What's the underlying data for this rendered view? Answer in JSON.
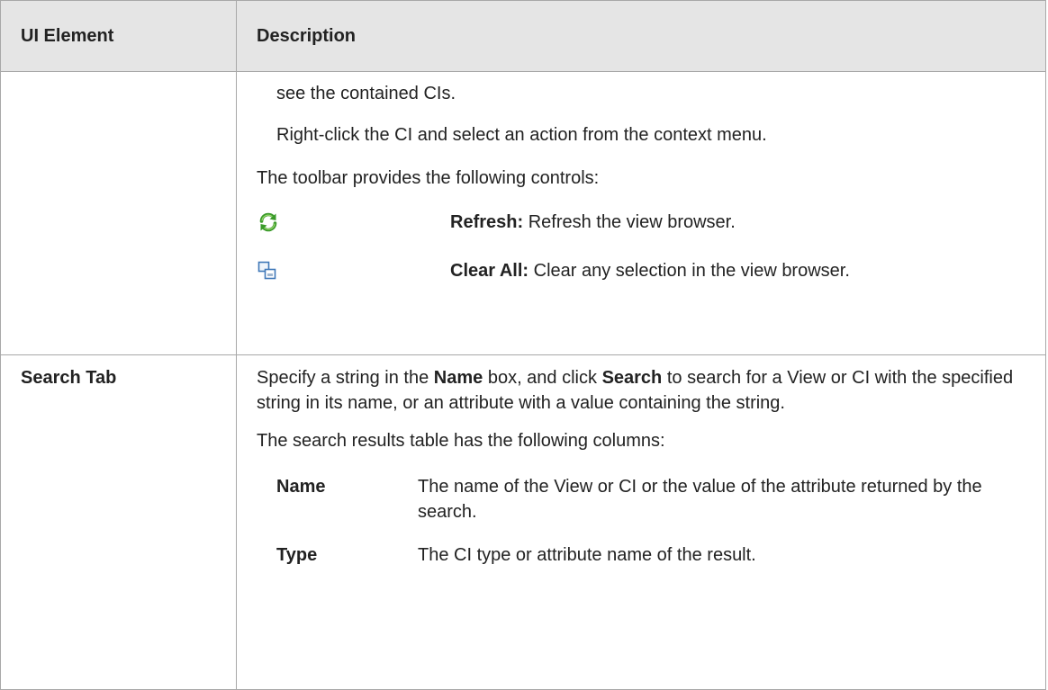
{
  "header": {
    "col_element": "UI Element",
    "col_description": "Description"
  },
  "row1": {
    "element": "",
    "line1": "see the contained CIs.",
    "line2": "Right-click the CI and select an action from the context menu.",
    "toolbar_intro": "The toolbar provides the following controls:",
    "controls": [
      {
        "icon": "refresh-icon",
        "name": "Refresh:",
        "text": " Refresh the view browser."
      },
      {
        "icon": "clear-all-icon",
        "name": "Clear All:",
        "text": " Clear any selection in the view browser."
      }
    ],
    "icon_colors": {
      "refresh": "#3a9a2a",
      "clear_all": "#3f78b8"
    }
  },
  "row2": {
    "element": "Search Tab",
    "desc_part1": "Specify a string in the ",
    "desc_bold1": "Name",
    "desc_part2": " box, and click ",
    "desc_bold2": "Search",
    "desc_part3": " to search for a View or CI with the specified string in its name, or an attribute with a value containing the string.",
    "columns_intro": "The search results table has the following columns:",
    "columns": [
      {
        "name": "Name",
        "text": "The name of the View or CI or the value of the attribute returned by the search."
      },
      {
        "name": "Type",
        "text": "The CI type or attribute name of the result."
      }
    ]
  }
}
